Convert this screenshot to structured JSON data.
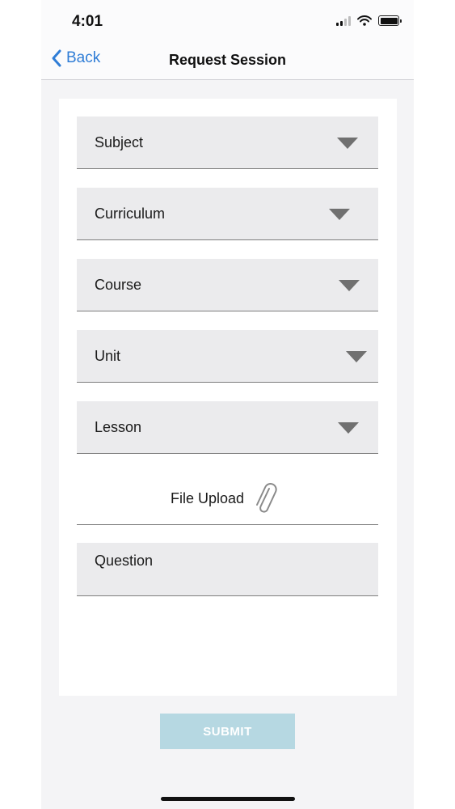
{
  "status_bar": {
    "time": "4:01",
    "icons": [
      "cellular-signal-icon",
      "wifi-icon",
      "battery-icon"
    ]
  },
  "nav": {
    "back_label": "Back",
    "title": "Request Session",
    "accent_color": "#2f7dd6"
  },
  "form": {
    "dropdowns": [
      {
        "label": "Subject"
      },
      {
        "label": "Curriculum"
      },
      {
        "label": "Course"
      },
      {
        "label": "Unit"
      },
      {
        "label": "Lesson"
      }
    ],
    "file_upload_label": "File Upload",
    "question_placeholder": "Question"
  },
  "submit": {
    "label": "SUBMIT",
    "color": "#b6d8e2"
  }
}
